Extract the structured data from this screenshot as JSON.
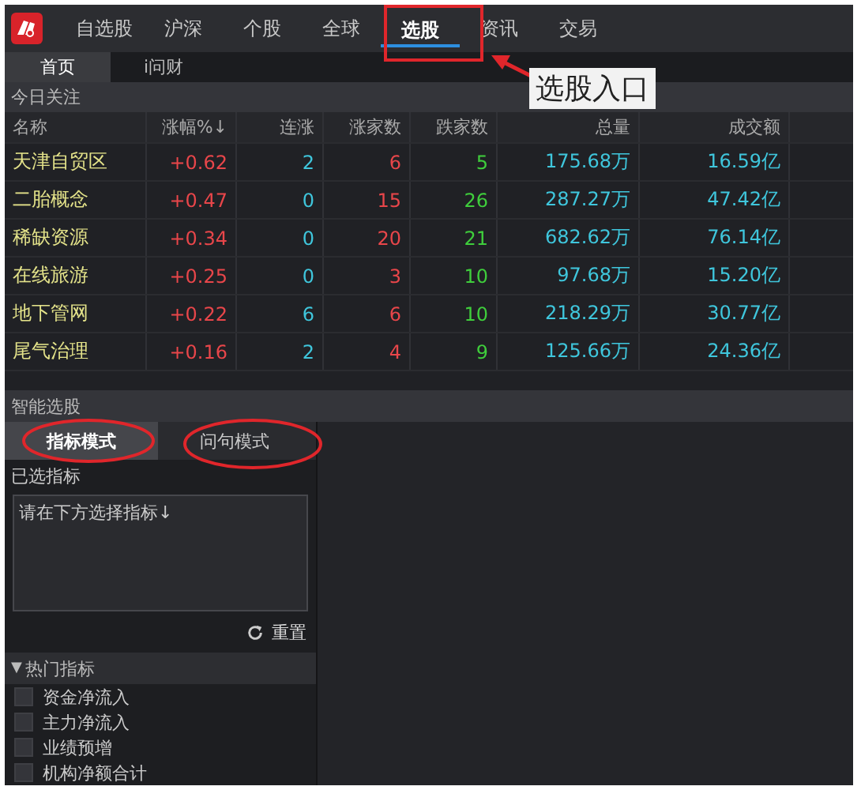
{
  "nav": {
    "items": [
      {
        "label": "自选股",
        "selected": false
      },
      {
        "label": "沪深",
        "selected": false
      },
      {
        "label": "个股",
        "selected": false
      },
      {
        "label": "全球",
        "selected": false
      },
      {
        "label": "选股",
        "selected": true
      },
      {
        "label": "资讯",
        "selected": false
      },
      {
        "label": "交易",
        "selected": false
      }
    ]
  },
  "subtabs": [
    {
      "label": "首页",
      "selected": true
    },
    {
      "label": "i问财",
      "selected": false
    }
  ],
  "annotation": {
    "text": "选股入口"
  },
  "today": {
    "title": "今日关注",
    "columns": [
      "名称",
      "涨幅%↓",
      "连涨",
      "涨家数",
      "跌家数",
      "总量",
      "成交额"
    ],
    "rows": [
      [
        "天津自贸区",
        "+0.62",
        "2",
        "6",
        "5",
        "175.68万",
        "16.59亿"
      ],
      [
        "二胎概念",
        "+0.47",
        "0",
        "15",
        "26",
        "287.27万",
        "47.42亿"
      ],
      [
        "稀缺资源",
        "+0.34",
        "0",
        "20",
        "21",
        "682.62万",
        "76.14亿"
      ],
      [
        "在线旅游",
        "+0.25",
        "0",
        "3",
        "10",
        "97.68万",
        "15.20亿"
      ],
      [
        "地下管网",
        "+0.22",
        "6",
        "6",
        "10",
        "218.29万",
        "30.77亿"
      ],
      [
        "尾气治理",
        "+0.16",
        "2",
        "4",
        "9",
        "125.66万",
        "24.36亿"
      ]
    ]
  },
  "picker": {
    "title": "智能选股",
    "tabs": [
      {
        "label": "指标模式",
        "selected": true
      },
      {
        "label": "问句模式",
        "selected": false
      }
    ],
    "selected_label": "已选指标",
    "placeholder": "请在下方选择指标↓",
    "reset": "重置",
    "group": {
      "title": "热门指标",
      "marker": "▼",
      "expanded": true,
      "items": [
        {
          "label": "资金净流入",
          "checked": false
        },
        {
          "label": "主力净流入",
          "checked": false
        },
        {
          "label": "业绩预增",
          "checked": false
        },
        {
          "label": "机构净额合计",
          "checked": false
        }
      ]
    }
  }
}
